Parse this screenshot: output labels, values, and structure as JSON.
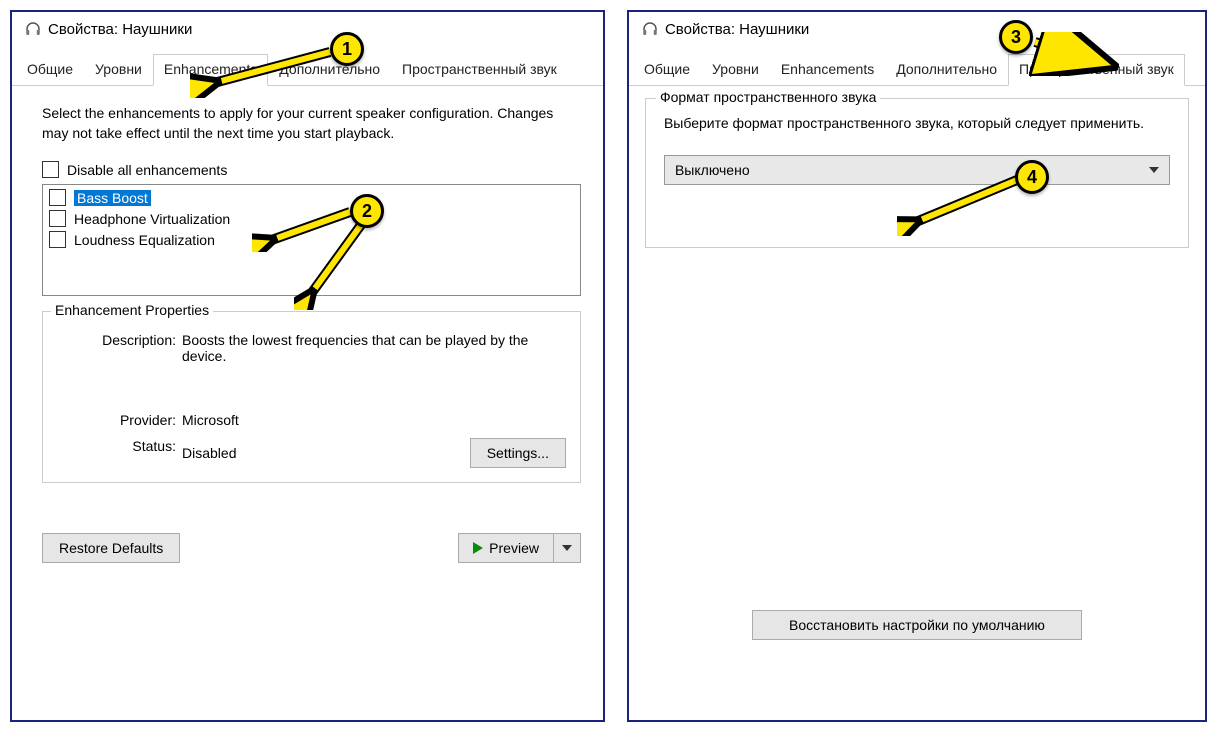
{
  "left": {
    "title": "Свойства: Наушники",
    "tabs": [
      "Общие",
      "Уровни",
      "Enhancements",
      "Дополнительно",
      "Пространственный звук"
    ],
    "active_tab": 2,
    "description": "Select the enhancements to apply for your current speaker configuration. Changes may not take effect until the next time you start playback.",
    "disable_all": "Disable all enhancements",
    "enhancements": [
      {
        "label": "Bass Boost",
        "selected": true
      },
      {
        "label": "Headphone Virtualization",
        "selected": false
      },
      {
        "label": "Loudness Equalization",
        "selected": false
      }
    ],
    "props_title": "Enhancement Properties",
    "props": {
      "desc_label": "Description:",
      "desc_value": "Boosts the lowest frequencies that can be played by the device.",
      "provider_label": "Provider:",
      "provider_value": "Microsoft",
      "status_label": "Status:",
      "status_value": "Disabled"
    },
    "settings_btn": "Settings...",
    "restore_btn": "Restore Defaults",
    "preview_btn": "Preview"
  },
  "right": {
    "title": "Свойства: Наушники",
    "tabs": [
      "Общие",
      "Уровни",
      "Enhancements",
      "Дополнительно",
      "Пространственный звук"
    ],
    "active_tab": 4,
    "group_title": "Формат пространственного звука",
    "group_desc": "Выберите формат пространственного звука, который следует применить.",
    "dropdown_value": "Выключено",
    "restore_btn": "Восстановить настройки по умолчанию"
  },
  "markers": {
    "m1": "1",
    "m2": "2",
    "m3": "3",
    "m4": "4"
  }
}
